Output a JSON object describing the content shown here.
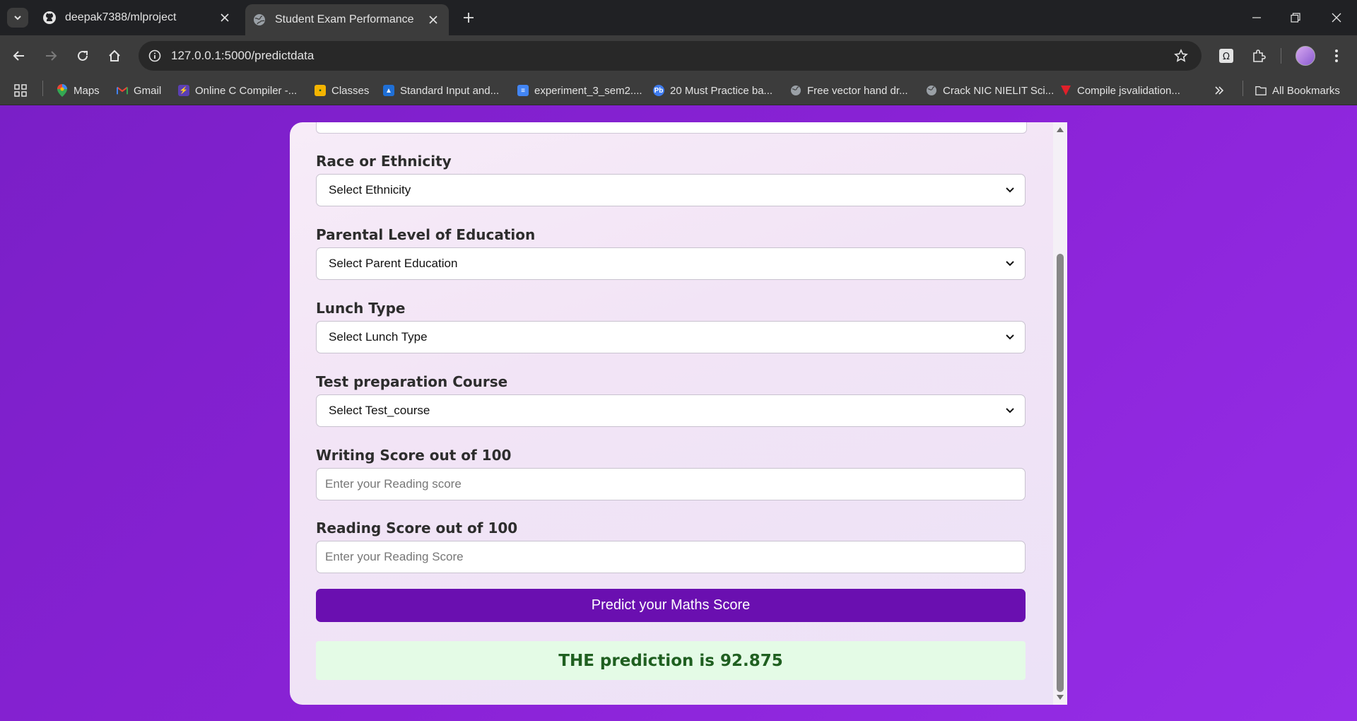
{
  "browser": {
    "tabs": [
      {
        "title": "deepak7388/mlproject",
        "icon": "github-icon",
        "active": false
      },
      {
        "title": "Student Exam Performance",
        "icon": "globe-icon",
        "active": true
      }
    ],
    "url": "127.0.0.1:5000/predictdata",
    "bookmarks": [
      {
        "label": "Maps",
        "icon": "maps-icon"
      },
      {
        "label": "Gmail",
        "icon": "gmail-icon"
      },
      {
        "label": "Online C Compiler -...",
        "icon": "compiler-icon"
      },
      {
        "label": "Classes",
        "icon": "classes-icon"
      },
      {
        "label": "Standard Input and...",
        "icon": "school-icon"
      },
      {
        "label": "experiment_3_sem2....",
        "icon": "docs-icon"
      },
      {
        "label": "20 Must Practice ba...",
        "icon": "pb-icon"
      },
      {
        "label": "Free vector hand dr...",
        "icon": "globe-icon"
      },
      {
        "label": "Crack NIC NIELIT Sci...",
        "icon": "globe-icon"
      },
      {
        "label": "Compile jsvalidation...",
        "icon": "v-icon"
      }
    ],
    "all_bookmarks": "All Bookmarks"
  },
  "form": {
    "fields": [
      {
        "label": "Race or Ethnicity",
        "type": "select",
        "value": "Select Ethnicity"
      },
      {
        "label": "Parental Level of Education",
        "type": "select",
        "value": "Select Parent Education"
      },
      {
        "label": "Lunch Type",
        "type": "select",
        "value": "Select Lunch Type"
      },
      {
        "label": "Test preparation Course",
        "type": "select",
        "value": "Select Test_course"
      },
      {
        "label": "Writing Score out of 100",
        "type": "input",
        "placeholder": "Enter your Reading score"
      },
      {
        "label": "Reading Score out of 100",
        "type": "input",
        "placeholder": "Enter your Reading Score"
      }
    ],
    "submit_label": "Predict your Maths Score",
    "result_text": "THE prediction is 92.875"
  },
  "colors": {
    "background": "#8a22d6",
    "button": "#6a0fb0",
    "result_bg": "#e4fbe6",
    "result_text": "#1f5f20"
  }
}
